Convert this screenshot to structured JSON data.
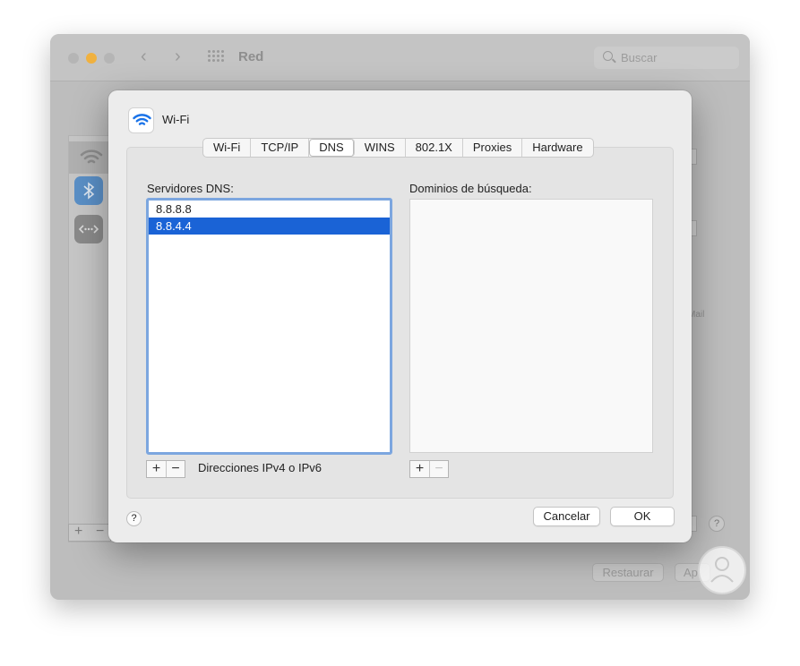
{
  "background_window": {
    "title": "Red",
    "search_placeholder": "Buscar",
    "partial_text_mail": "Mail",
    "restore_label": "Restaurar",
    "apply_label": "Ap",
    "help_label": "?",
    "add_label": "+",
    "remove_label": "−"
  },
  "sheet": {
    "title": "Wi-Fi",
    "tabs": [
      {
        "label": "Wi-Fi",
        "selected": false
      },
      {
        "label": "TCP/IP",
        "selected": false
      },
      {
        "label": "DNS",
        "selected": true
      },
      {
        "label": "WINS",
        "selected": false
      },
      {
        "label": "802.1X",
        "selected": false
      },
      {
        "label": "Proxies",
        "selected": false
      },
      {
        "label": "Hardware",
        "selected": false
      }
    ],
    "dns": {
      "label": "Servidores DNS:",
      "servers": [
        "8.8.8.8",
        "8.8.4.4"
      ],
      "selected_index": 1,
      "add_label": "+",
      "remove_label": "−",
      "hint": "Direcciones IPv4 o IPv6"
    },
    "search_domains": {
      "label": "Dominios de búsqueda:",
      "items": [],
      "add_label": "+",
      "remove_label": "−"
    },
    "help_label": "?",
    "cancel_label": "Cancelar",
    "ok_label": "OK"
  },
  "colors": {
    "accent": "#1a63d6",
    "focus_ring": "#7ca6df",
    "wifi_icon": "#1a73e8",
    "minimize": "#f0b13f"
  }
}
